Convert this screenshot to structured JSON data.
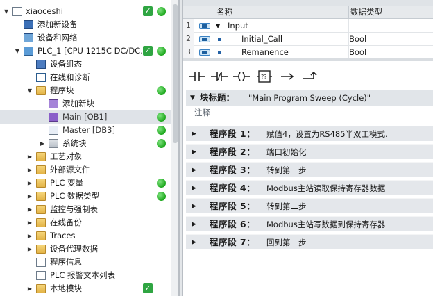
{
  "tree": {
    "items": [
      {
        "label": "xiaoceshi",
        "toggle": "▼",
        "icon": "document-icon",
        "check": true,
        "dot": true
      },
      {
        "label": "添加新设备",
        "toggle": "",
        "icon": "add-device-icon",
        "check": false,
        "dot": false
      },
      {
        "label": "设备和网络",
        "toggle": "",
        "icon": "network-icon",
        "check": false,
        "dot": false
      },
      {
        "label": "PLC_1 [CPU 1215C DC/DC...",
        "toggle": "▼",
        "icon": "plc-icon",
        "check": true,
        "dot": true
      },
      {
        "label": "设备组态",
        "toggle": "",
        "icon": "device-config-icon",
        "check": false,
        "dot": false
      },
      {
        "label": "在线和诊断",
        "toggle": "",
        "icon": "online-diagnostics-icon",
        "check": false,
        "dot": false
      },
      {
        "label": "程序块",
        "toggle": "▼",
        "icon": "folder-icon",
        "check": false,
        "dot": true
      },
      {
        "label": "添加新块",
        "toggle": "",
        "icon": "add-block-icon",
        "check": false,
        "dot": false
      },
      {
        "label": "Main [OB1]",
        "toggle": "",
        "icon": "ob-block-icon",
        "check": false,
        "dot": true
      },
      {
        "label": "Master [DB3]",
        "toggle": "",
        "icon": "db-block-icon",
        "check": false,
        "dot": true
      },
      {
        "label": "系统块",
        "toggle": "▶",
        "icon": "system-block-icon",
        "check": false,
        "dot": true
      },
      {
        "label": "工艺对象",
        "toggle": "▶",
        "icon": "folder-icon",
        "check": false,
        "dot": false
      },
      {
        "label": "外部源文件",
        "toggle": "▶",
        "icon": "folder-icon",
        "check": false,
        "dot": false
      },
      {
        "label": "PLC 变量",
        "toggle": "▶",
        "icon": "tag-table-icon",
        "check": false,
        "dot": true
      },
      {
        "label": "PLC 数据类型",
        "toggle": "▶",
        "icon": "data-type-icon",
        "check": false,
        "dot": true
      },
      {
        "label": "监控与强制表",
        "toggle": "▶",
        "icon": "folder-icon",
        "check": false,
        "dot": false
      },
      {
        "label": "在线备份",
        "toggle": "▶",
        "icon": "folder-icon",
        "check": false,
        "dot": false
      },
      {
        "label": "Traces",
        "toggle": "▶",
        "icon": "folder-icon",
        "check": false,
        "dot": false
      },
      {
        "label": "设备代理数据",
        "toggle": "▶",
        "icon": "folder-icon",
        "check": false,
        "dot": false
      },
      {
        "label": "程序信息",
        "toggle": "",
        "icon": "program-info-icon",
        "check": false,
        "dot": false
      },
      {
        "label": "PLC 报警文本列表",
        "toggle": "",
        "icon": "alarm-text-icon",
        "check": false,
        "dot": false
      },
      {
        "label": "本地模块",
        "toggle": "▶",
        "icon": "folder-icon",
        "check": true,
        "dot": false
      }
    ]
  },
  "interface": {
    "header_name": "名称",
    "header_type": "数据类型",
    "rows": [
      {
        "num": "1",
        "name": "Input",
        "type": "",
        "expand": "▼"
      },
      {
        "num": "2",
        "name": "Initial_Call",
        "type": "Bool",
        "expand": ""
      },
      {
        "num": "3",
        "name": "Remanence",
        "type": "Bool",
        "expand": ""
      }
    ]
  },
  "toolbar": {
    "buttons": [
      "normally-open-contact",
      "normally-closed-contact",
      "coil",
      "empty-box",
      "open-branch",
      "close-branch"
    ]
  },
  "block": {
    "title_label": "块标题：",
    "title_value": "\"Main Program Sweep (Cycle)\"",
    "comment": "注释"
  },
  "networks": [
    {
      "label": "程序段 1：",
      "comment": "赋值4，设置为RS485半双工模式."
    },
    {
      "label": "程序段 2：",
      "comment": "端口初始化"
    },
    {
      "label": "程序段 3：",
      "comment": "转到第一步"
    },
    {
      "label": "程序段 4：",
      "comment": "Modbus主站读取保持寄存器数据"
    },
    {
      "label": "程序段 5：",
      "comment": "转到第二步"
    },
    {
      "label": "程序段 6：",
      "comment": "Modbus主站写数据到保持寄存器"
    },
    {
      "label": "程序段 7：",
      "comment": "回到第一步"
    }
  ],
  "colors": {
    "status_green": "#2fa542",
    "selection": "#dfe3e8",
    "network_header": "#e4e7eb"
  }
}
